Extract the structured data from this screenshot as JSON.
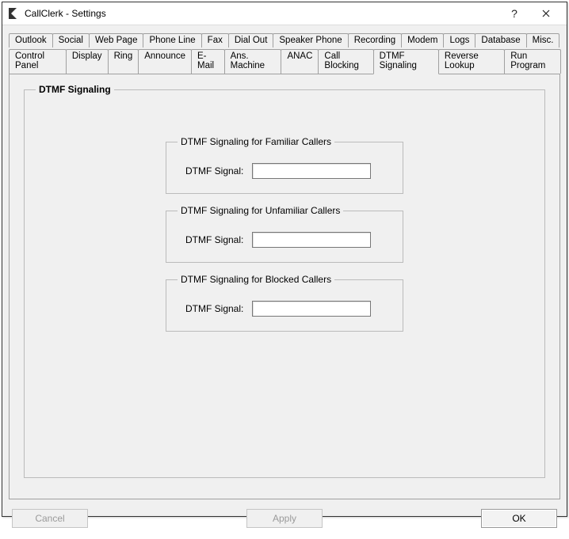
{
  "window": {
    "title": "CallClerk - Settings",
    "help_label": "?",
    "close_label": "✕"
  },
  "tabs_row1": [
    "Outlook",
    "Social",
    "Web Page",
    "Phone Line",
    "Fax",
    "Dial Out",
    "Speaker Phone",
    "Recording",
    "Modem",
    "Logs",
    "Database",
    "Misc."
  ],
  "tabs_row2": [
    "Control Panel",
    "Display",
    "Ring",
    "Announce",
    "E-Mail",
    "Ans. Machine",
    "ANAC",
    "Call Blocking",
    "DTMF Signaling",
    "Reverse Lookup",
    "Run Program"
  ],
  "active_tab": "DTMF Signaling",
  "panel": {
    "group_title": "DTMF Signaling",
    "sections": [
      {
        "title": "DTMF Signaling for Familiar Callers",
        "label": "DTMF Signal:",
        "value": ""
      },
      {
        "title": "DTMF Signaling for Unfamiliar Callers",
        "label": "DTMF Signal:",
        "value": ""
      },
      {
        "title": "DTMF Signaling for Blocked Callers",
        "label": "DTMF Signal:",
        "value": ""
      }
    ]
  },
  "buttons": {
    "cancel": "Cancel",
    "apply": "Apply",
    "ok": "OK"
  }
}
